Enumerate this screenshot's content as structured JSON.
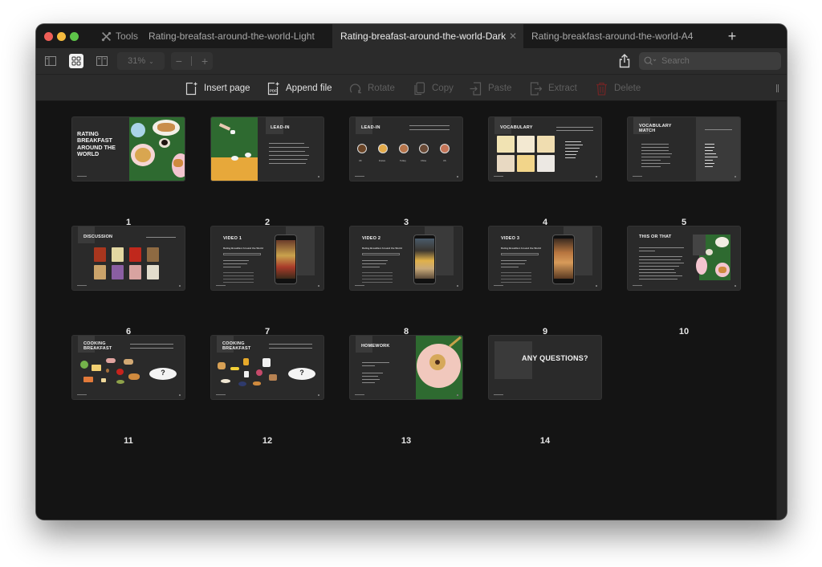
{
  "window": {
    "tools_label": "Tools",
    "tabs": [
      {
        "label": "Rating-breafast-around-the-world-Light",
        "active": false
      },
      {
        "label": "Rating-breafast-around-the-world-Dark",
        "active": true
      },
      {
        "label": "Rating-breakfast-around-the-world-A4",
        "active": false
      }
    ],
    "close_tab_glyph": "✕",
    "new_tab_glyph": "+"
  },
  "toolbar": {
    "view_buttons": [
      {
        "name": "sidebar-view",
        "icon": "sidebar-icon",
        "active": false
      },
      {
        "name": "grid-view",
        "icon": "grid-icon",
        "active": true
      },
      {
        "name": "two-page-view",
        "icon": "two-page-icon",
        "active": false
      }
    ],
    "zoom_level": "31%",
    "zoom_out_glyph": "−",
    "zoom_in_glyph": "+",
    "search_placeholder": "Search"
  },
  "actions": [
    {
      "label": "Insert page",
      "icon": "insert-page-icon",
      "enabled": true
    },
    {
      "label": "Append file",
      "icon": "append-pdf-icon",
      "enabled": true
    },
    {
      "label": "Rotate",
      "icon": "rotate-icon",
      "enabled": false
    },
    {
      "label": "Copy",
      "icon": "copy-icon",
      "enabled": false
    },
    {
      "label": "Paste",
      "icon": "paste-icon",
      "enabled": false
    },
    {
      "label": "Extract",
      "icon": "extract-icon",
      "enabled": false
    },
    {
      "label": "Delete",
      "icon": "trash-icon",
      "enabled": false
    }
  ],
  "colors": {
    "delete_icon": "#7a2a2a",
    "slide_bg": "#2a2a2a",
    "green_photo": "#2f6b2f"
  },
  "pages": [
    {
      "number": "1",
      "title": "RATING BREAKFAST AROUND THE WORLD"
    },
    {
      "number": "2",
      "title": "LEAD-IN"
    },
    {
      "number": "3",
      "title": "LEAD-IN",
      "labels": [
        "UK",
        "France",
        "Turkey",
        "China",
        "US"
      ]
    },
    {
      "number": "4",
      "title": "VOCABULARY"
    },
    {
      "number": "5",
      "title": "VOCABULARY MATCH"
    },
    {
      "number": "6",
      "title": "DISCUSSION"
    },
    {
      "number": "7",
      "title": "VIDEO 1",
      "subtitle": "Rating Breakfast Around the World"
    },
    {
      "number": "8",
      "title": "VIDEO 2",
      "subtitle": "Rating Breakfast Around the World"
    },
    {
      "number": "9",
      "title": "VIDEO 3",
      "subtitle": "Rating Breakfast Around the World"
    },
    {
      "number": "10",
      "title": "THIS OR THAT"
    },
    {
      "number": "11",
      "title": "COOKING BREAKFAST"
    },
    {
      "number": "12",
      "title": "COOKING BREAKFAST"
    },
    {
      "number": "13",
      "title": "HOMEWORK"
    },
    {
      "number": "14",
      "title": "ANY QUESTIONS?"
    }
  ]
}
